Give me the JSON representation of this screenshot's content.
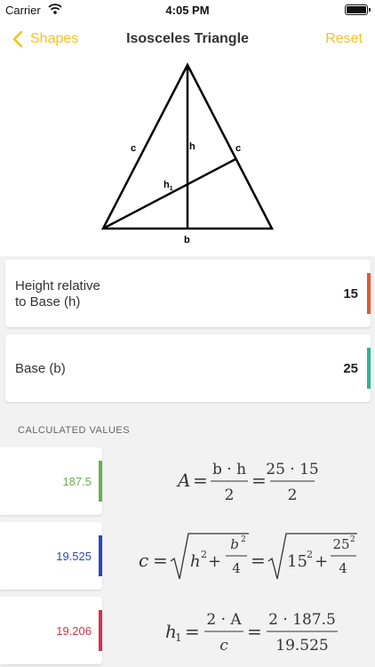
{
  "status_bar": {
    "carrier": "Carrier",
    "time": "4:05 PM"
  },
  "nav": {
    "back_label": "Shapes",
    "title": "Isosceles Triangle",
    "reset_label": "Reset"
  },
  "diagram": {
    "label_c_left": "c",
    "label_h": "h",
    "label_c_right": "c",
    "label_h1": "h",
    "label_h1_sub": "1",
    "label_b": "b"
  },
  "inputs": [
    {
      "label_line1": "Height relative",
      "label_line2": "to Base (h)",
      "value": "15",
      "accent_color": "#e4572e"
    },
    {
      "label_line1": "Base (b)",
      "value": "25",
      "accent_color": "#2bb597"
    }
  ],
  "calculated_header": "CALCULATED VALUES",
  "results": [
    {
      "value": "187.5",
      "color": "#6ab04c"
    },
    {
      "value": "19.525",
      "color": "#2f46b8"
    },
    {
      "value": "19.206",
      "color": "#d6304e"
    }
  ],
  "formulas": {
    "area": {
      "lhs": "A",
      "num1": "b · h",
      "den1": "2",
      "num2": "25 · 15",
      "den2": "2"
    },
    "side": {
      "lhs": "c",
      "h2": "h",
      "exp": "2",
      "plus": "+",
      "b2": "b",
      "four": "4",
      "v15": "15",
      "v25": "25"
    },
    "height1": {
      "lhs": "h",
      "lhs_sub": "1",
      "num1": "2 · A",
      "den1": "c",
      "num2": "2 · 187.5",
      "den2": "19.525"
    }
  }
}
